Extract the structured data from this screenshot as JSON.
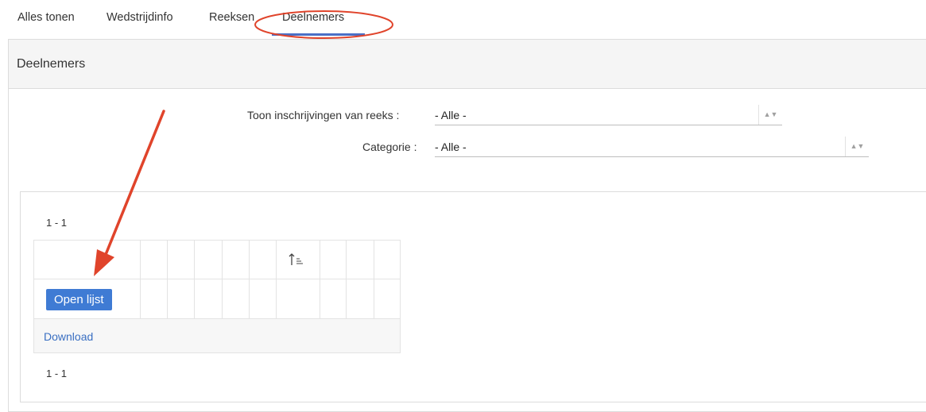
{
  "tabs": [
    {
      "label": "Alles tonen"
    },
    {
      "label": "Wedstrijdinfo"
    },
    {
      "label": "Reeksen"
    },
    {
      "label": "Deelnemers"
    }
  ],
  "active_tab_index": 3,
  "panel": {
    "title": "Deelnemers"
  },
  "filters": {
    "reeks": {
      "label": "Toon inschrijvingen van reeks :",
      "value": "- Alle -"
    },
    "categorie": {
      "label": "Categorie :",
      "value": "- Alle -"
    }
  },
  "results": {
    "pager_top": "1 - 1",
    "pager_bottom": "1 - 1",
    "open_button_label": "Open lijst",
    "download_label": "Download",
    "sort_icon": "sort-ascending-icon"
  },
  "colors": {
    "accent": "#3f7bd4",
    "link": "#3a6fc2",
    "annotation": "#e0442b",
    "tab_underline": "#4a6fc6"
  }
}
